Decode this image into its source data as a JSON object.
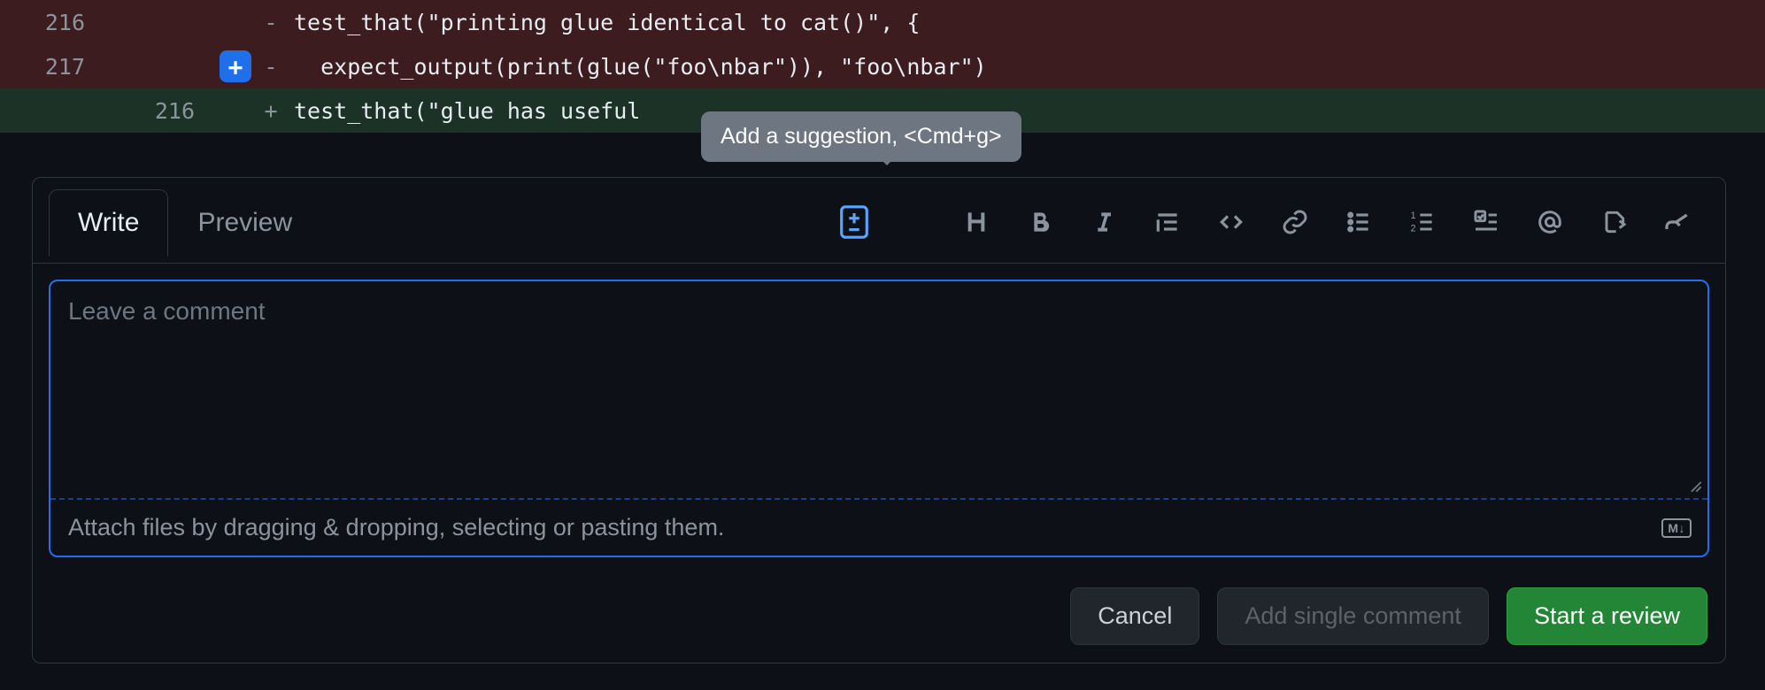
{
  "diff": {
    "rows": [
      {
        "old_ln": "216",
        "new_ln": "",
        "sign": "-",
        "code": "test_that(\"printing glue identical to cat()\", {",
        "kind": "del"
      },
      {
        "old_ln": "217",
        "new_ln": "",
        "sign": "-",
        "code": "  expect_output(print(glue(\"foo\\nbar\")), \"foo\\nbar\")",
        "kind": "del"
      },
      {
        "old_ln": "",
        "new_ln": "216",
        "sign": "+",
        "code": "test_that(\"glue has useful",
        "kind": "add"
      }
    ]
  },
  "tooltip": {
    "text": "Add a suggestion, <Cmd+g>"
  },
  "editor": {
    "tabs": {
      "write": "Write",
      "preview": "Preview"
    },
    "placeholder": "Leave a comment",
    "attach_hint": "Attach files by dragging & dropping, selecting or pasting them.",
    "markdown_badge": "M↓"
  },
  "buttons": {
    "cancel": "Cancel",
    "add_single": "Add single comment",
    "start_review": "Start a review"
  }
}
